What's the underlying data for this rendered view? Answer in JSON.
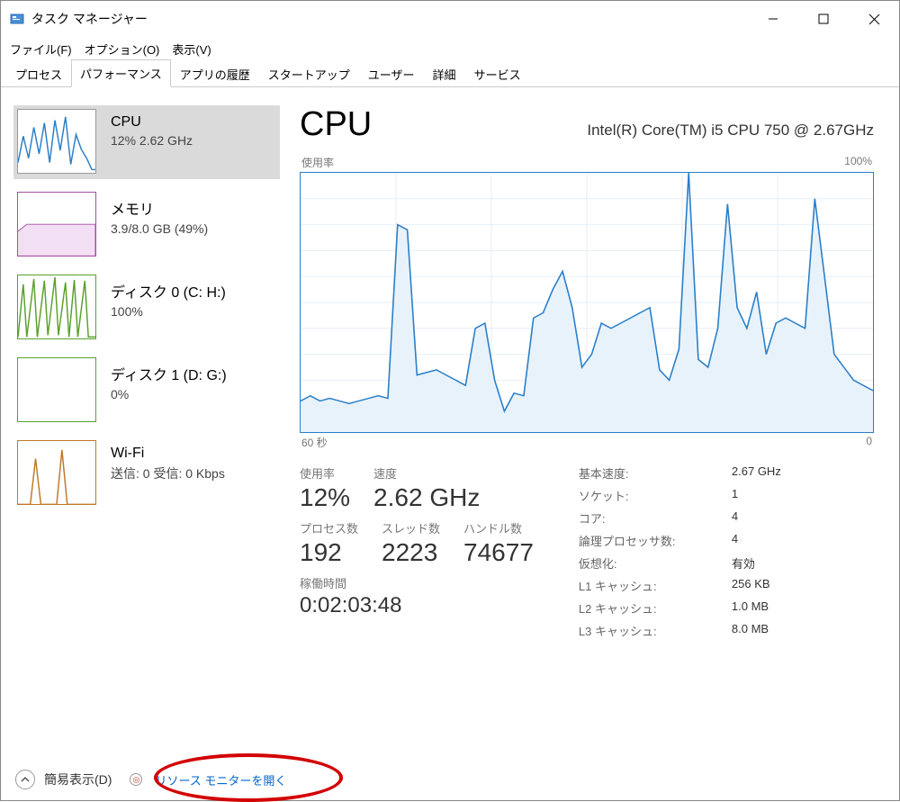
{
  "window": {
    "title": "タスク マネージャー"
  },
  "menu": {
    "file": "ファイル(F)",
    "options": "オプション(O)",
    "view": "表示(V)"
  },
  "tabs": {
    "processes": "プロセス",
    "performance": "パフォーマンス",
    "apphistory": "アプリの履歴",
    "startup": "スタートアップ",
    "users": "ユーザー",
    "details": "詳細",
    "services": "サービス"
  },
  "sidebar": {
    "cpu": {
      "title": "CPU",
      "sub": "12%  2.62 GHz"
    },
    "mem": {
      "title": "メモリ",
      "sub": "3.9/8.0 GB (49%)"
    },
    "disk0": {
      "title": "ディスク 0 (C: H:)",
      "sub": "100%"
    },
    "disk1": {
      "title": "ディスク 1 (D: G:)",
      "sub": "0%"
    },
    "wifi": {
      "title": "Wi-Fi",
      "sub": "送信: 0  受信: 0 Kbps"
    }
  },
  "detail": {
    "heading": "CPU",
    "model": "Intel(R) Core(TM) i5 CPU 750 @ 2.67GHz",
    "chart_tl": "使用率",
    "chart_tr": "100%",
    "chart_bl": "60 秒",
    "chart_br": "0",
    "left": {
      "util_lbl": "使用率",
      "util_val": "12%",
      "speed_lbl": "速度",
      "speed_val": "2.62 GHz",
      "procs_lbl": "プロセス数",
      "procs_val": "192",
      "threads_lbl": "スレッド数",
      "threads_val": "2223",
      "handles_lbl": "ハンドル数",
      "handles_val": "74677",
      "uptime_lbl": "稼働時間",
      "uptime_val": "0:02:03:48"
    },
    "right": {
      "base_lbl": "基本速度:",
      "base_val": "2.67 GHz",
      "sockets_lbl": "ソケット:",
      "sockets_val": "1",
      "cores_lbl": "コア:",
      "cores_val": "4",
      "lproc_lbl": "論理プロセッサ数:",
      "lproc_val": "4",
      "virt_lbl": "仮想化:",
      "virt_val": "有効",
      "l1_lbl": "L1 キャッシュ:",
      "l1_val": "256 KB",
      "l2_lbl": "L2 キャッシュ:",
      "l2_val": "1.0 MB",
      "l3_lbl": "L3 キャッシュ:",
      "l3_val": "8.0 MB"
    }
  },
  "footer": {
    "fewer": "簡易表示(D)",
    "resmon": "リソース モニターを開く"
  },
  "chart_data": {
    "type": "line",
    "title": "使用率",
    "xlabel": "60 秒 → 0",
    "ylabel": "%",
    "ylim": [
      0,
      100
    ],
    "x": [
      0,
      1,
      2,
      3,
      4,
      5,
      6,
      7,
      8,
      9,
      10,
      11,
      12,
      13,
      14,
      15,
      16,
      17,
      18,
      19,
      20,
      21,
      22,
      23,
      24,
      25,
      26,
      27,
      28,
      29,
      30,
      31,
      32,
      33,
      34,
      35,
      36,
      37,
      38,
      39,
      40,
      41,
      42,
      43,
      44,
      45,
      46,
      47,
      48,
      49,
      50,
      51,
      52,
      53,
      54,
      55,
      56,
      57,
      58,
      59
    ],
    "values": [
      12,
      14,
      12,
      13,
      12,
      11,
      12,
      13,
      14,
      13,
      80,
      78,
      22,
      23,
      24,
      22,
      20,
      18,
      40,
      42,
      20,
      8,
      15,
      14,
      44,
      46,
      55,
      62,
      48,
      25,
      30,
      42,
      40,
      42,
      44,
      46,
      48,
      24,
      20,
      32,
      100,
      28,
      25,
      40,
      88,
      48,
      40,
      54,
      30,
      42,
      44,
      42,
      40,
      90,
      60,
      30,
      25,
      20,
      18,
      16
    ]
  }
}
